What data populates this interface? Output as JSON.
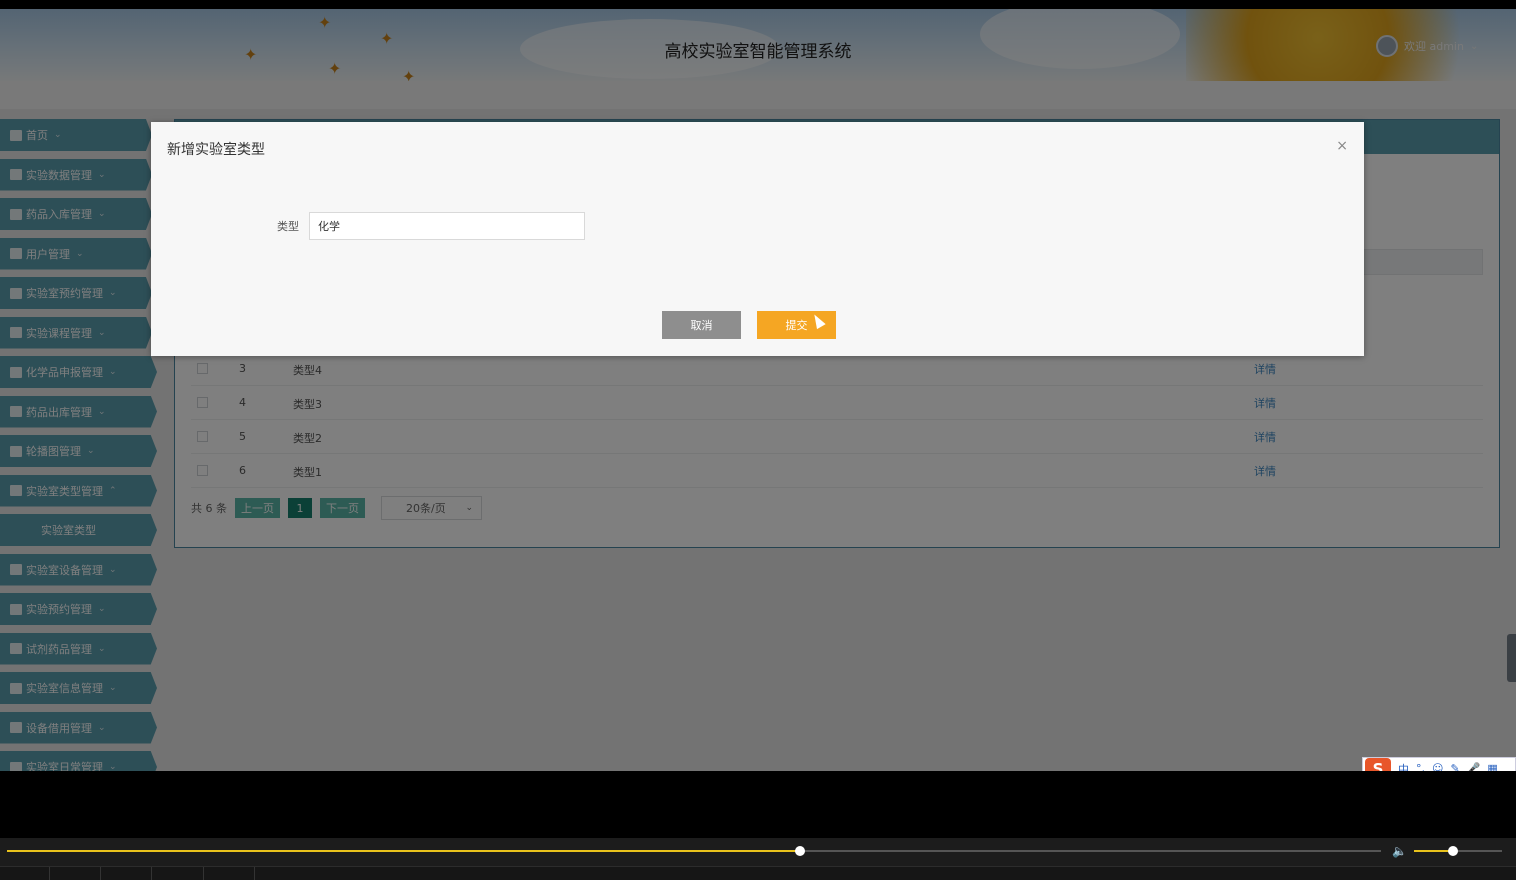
{
  "header": {
    "title": "高校实验室智能管理系统",
    "welcome": "欢迎 admin"
  },
  "sidebar": {
    "items": [
      {
        "label": "首页",
        "icon": "home-icon"
      },
      {
        "label": "实验数据管理",
        "icon": "data-icon"
      },
      {
        "label": "药品入库管理",
        "icon": "inbound-icon"
      },
      {
        "label": "用户管理",
        "icon": "user-icon"
      },
      {
        "label": "实验室预约管理",
        "icon": "grid-icon"
      },
      {
        "label": "实验课程管理",
        "icon": "course-icon"
      },
      {
        "label": "化学品申报管理",
        "icon": "chemical-icon"
      },
      {
        "label": "药品出库管理",
        "icon": "outbound-icon"
      },
      {
        "label": "轮播图管理",
        "icon": "carousel-icon"
      },
      {
        "label": "实验室类型管理",
        "icon": "type-icon",
        "expanded": true
      },
      {
        "label": "实验室设备管理",
        "icon": "equipment-icon"
      },
      {
        "label": "实验预约管理",
        "icon": "reserve-icon"
      },
      {
        "label": "试剂药品管理",
        "icon": "reagent-icon"
      },
      {
        "label": "实验室信息管理",
        "icon": "info-icon"
      },
      {
        "label": "设备借用管理",
        "icon": "borrow-icon"
      },
      {
        "label": "实验室日常管理",
        "icon": "daily-icon"
      }
    ],
    "subitem": "实验室类型"
  },
  "table": {
    "rows": [
      {
        "idx": "3",
        "name": "类型4",
        "action": "详情"
      },
      {
        "idx": "4",
        "name": "类型3",
        "action": "详情"
      },
      {
        "idx": "5",
        "name": "类型2",
        "action": "详情"
      },
      {
        "idx": "6",
        "name": "类型1",
        "action": "详情"
      }
    ]
  },
  "pager": {
    "total": "共 6 条",
    "prev": "上一页",
    "current": "1",
    "next": "下一页",
    "page_size": "20条/页"
  },
  "modal": {
    "title": "新增实验室类型",
    "close": "×",
    "field_label": "类型",
    "field_value": "化学",
    "cancel": "取消",
    "submit": "提交"
  },
  "ime": {
    "logo": "S",
    "lang": "中",
    "punct": "°,",
    "emoji": "☺",
    "skin": "✎",
    "mic": "🎤",
    "grid": "▦"
  },
  "player": {
    "progress": 0.577,
    "volume": 0.44
  },
  "colors": {
    "sidebar": "#5b9eae",
    "submit": "#f5a623",
    "cancel": "#8e8e8e",
    "pager": "#5bb7a8",
    "progress": "#e8c21c"
  }
}
